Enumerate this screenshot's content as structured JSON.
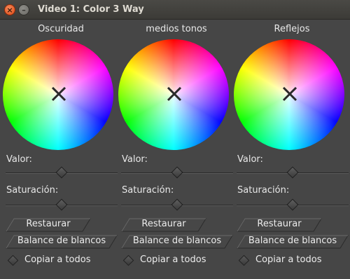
{
  "window": {
    "title": "Video 1: Color 3 Way",
    "close_glyph": "×",
    "minimize_glyph": "–"
  },
  "columns": [
    {
      "label": "Oscuridad",
      "valor_label": "Valor:",
      "valor_level": 0.5,
      "saturacion_label": "Saturación:",
      "saturacion_level": 0.5,
      "reset_label": "Restaurar",
      "white_balance_label": "Balance de blancos",
      "copy_all_label": "Copiar a todos"
    },
    {
      "label": "medios tonos",
      "valor_label": "Valor:",
      "valor_level": 0.5,
      "saturacion_label": "Saturación:",
      "saturacion_level": 0.5,
      "reset_label": "Restaurar",
      "white_balance_label": "Balance de blancos",
      "copy_all_label": "Copiar a todos"
    },
    {
      "label": "Reflejos",
      "valor_label": "Valor:",
      "valor_level": 0.5,
      "saturacion_label": "Saturación:",
      "saturacion_level": 0.5,
      "reset_label": "Restaurar",
      "white_balance_label": "Balance de blancos",
      "copy_all_label": "Copiar a todos"
    }
  ],
  "colors": {
    "background": "#464646",
    "titlebar": "#3c3b37",
    "close_button": "#df4a16",
    "text": "#e8e8e8"
  }
}
